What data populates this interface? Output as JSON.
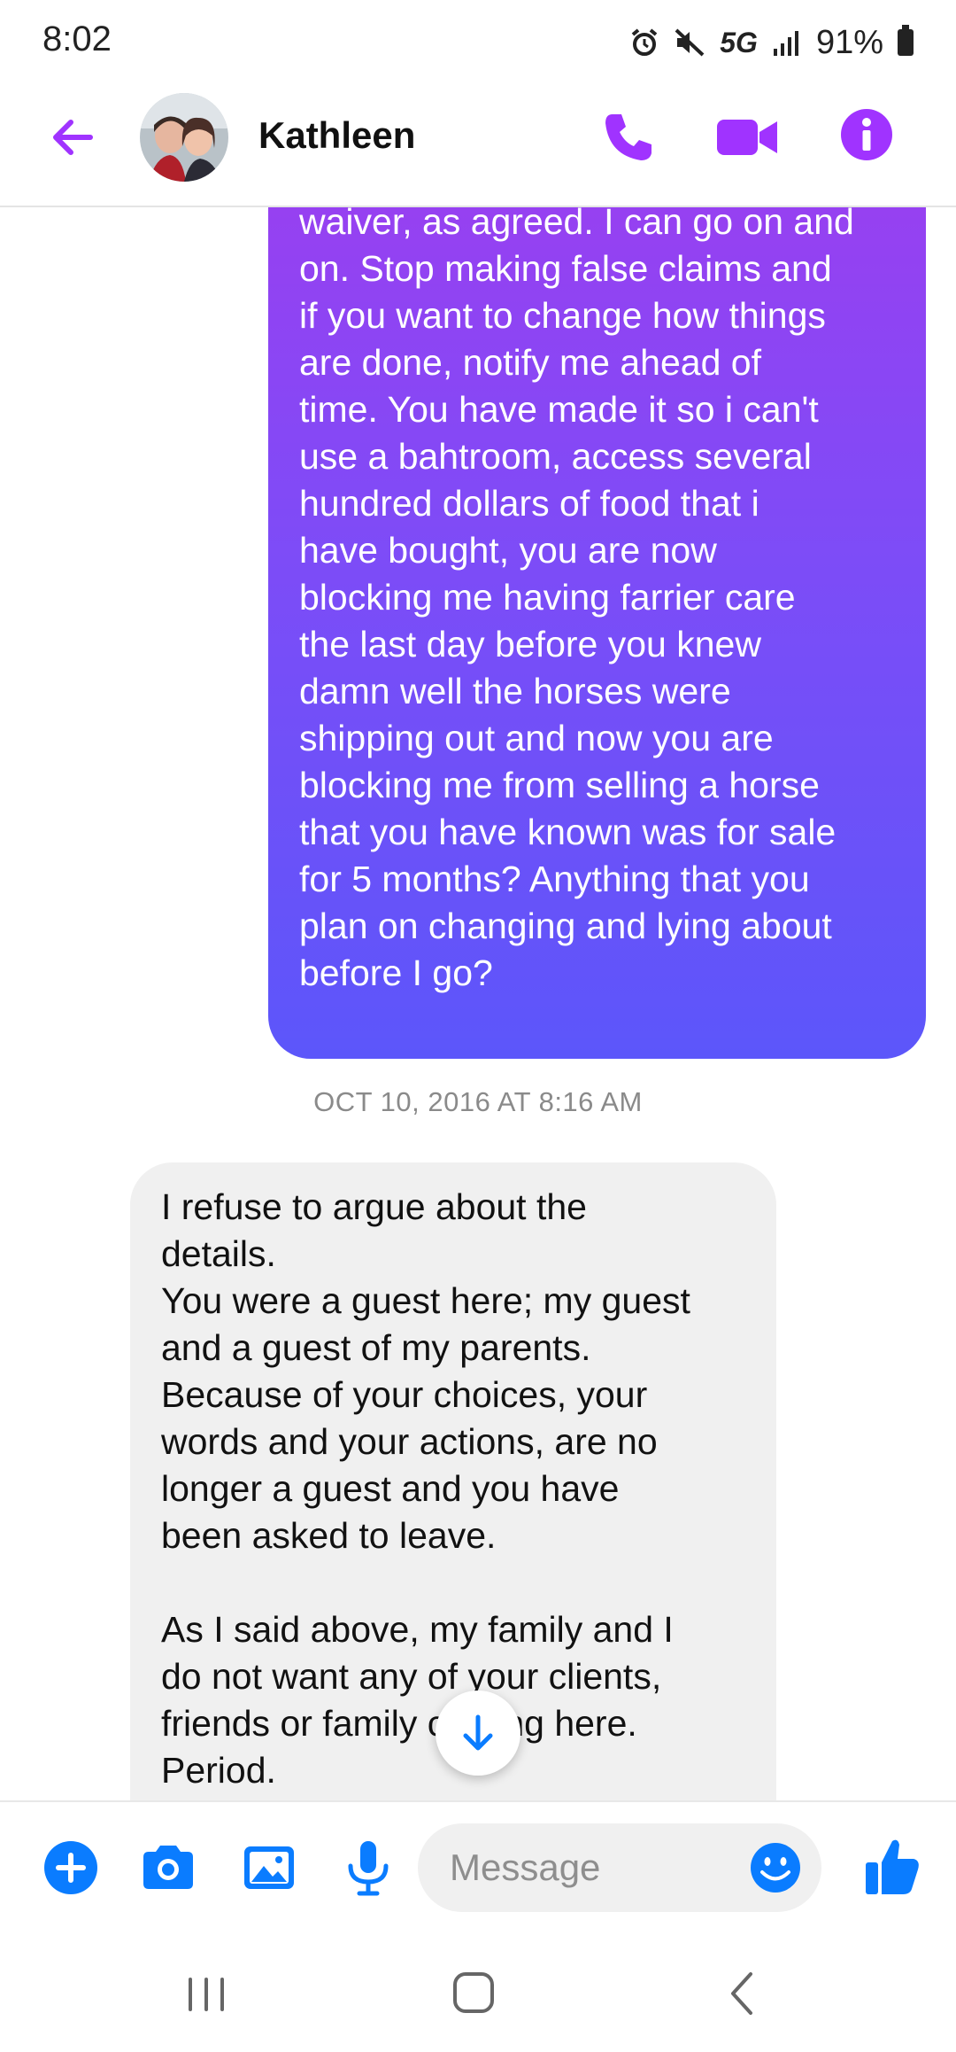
{
  "status_bar": {
    "time": "8:02",
    "network": "5G",
    "battery": "91%",
    "icons": [
      "alarm-icon",
      "mute-icon",
      "signal-icon",
      "battery-icon"
    ]
  },
  "header": {
    "contact_name": "Kathleen",
    "icons": [
      "back-arrow-icon",
      "phone-icon",
      "video-camera-icon",
      "info-icon"
    ],
    "accent_color": "#a033ff"
  },
  "conversation": {
    "sent_message": "waiver, as agreed. I can go on and\non. Stop making false claims and\nif you want to change how things\nare done, notify me ahead of\ntime. You have made it so i can't\nuse a bahtroom, access several\nhundred dollars of food that i\nhave bought, you are now\nblocking me having farrier care\nthe last day before you knew\ndamn well the horses were\nshipping out and now you are\nblocking me from selling a horse\nthat you have known was for sale\nfor 5 months? Anything that you\nplan on changing and lying about\nbefore I go?",
    "timestamp": "OCT 10, 2016 AT 8:16 AM",
    "received_message": "I refuse to argue about the\ndetails.\nYou were a guest here; my guest\nand a guest of my parents.\nBecause of your choices, your\nwords and your actions, are no\nlonger a guest and you have\nbeen asked to leave.\n\nAs I said above, my family and I\ndo not want any of your clients,\nfriends or family coming here.\nPeriod.",
    "sent_gradient": [
      "#9a3ff0",
      "#5c56fa"
    ],
    "received_bg": "#f0f0f0"
  },
  "composer": {
    "placeholder": "Message",
    "icons": [
      "plus-icon",
      "camera-icon",
      "gallery-icon",
      "microphone-icon",
      "emoji-icon",
      "thumbs-up-icon"
    ],
    "accent_color": "#0a7cff"
  },
  "nav_bar": {
    "icons": [
      "recent-apps-icon",
      "home-icon",
      "back-icon"
    ]
  }
}
